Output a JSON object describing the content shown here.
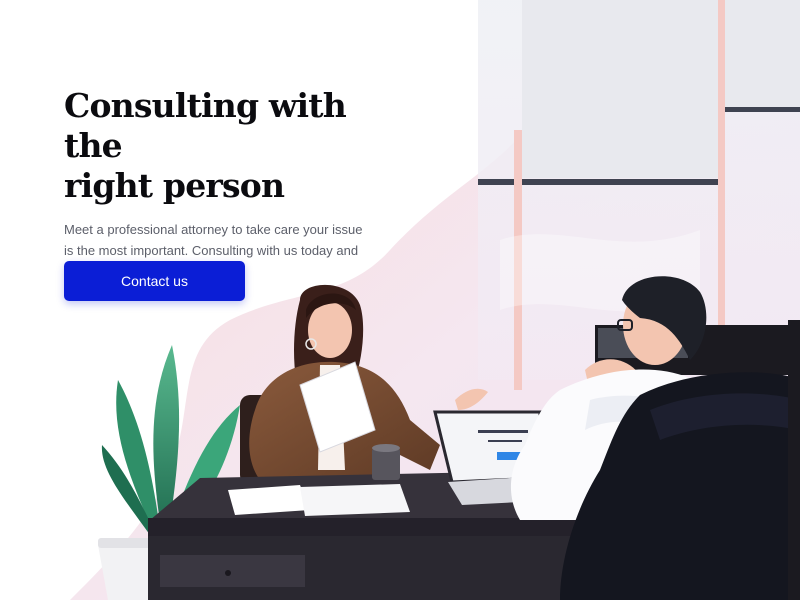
{
  "hero": {
    "headline_line1": "Consulting with the",
    "headline_line2": "right person",
    "subtitle": "Meet a professional attorney to take care your issue is the most important. Consulting with us today and let us take care your matter.",
    "cta_label": "Contact us"
  },
  "colors": {
    "accent": "#0b1ed6",
    "headline": "#0b0b0f",
    "body_text": "#5c5f6a",
    "blob": "#f6e7ea",
    "desk": "#2a2830"
  },
  "illustration": {
    "icons": [
      "office-window-icon",
      "plant-icon",
      "woman-with-paper-icon",
      "man-with-glasses-icon",
      "laptop-icon",
      "coffee-cup-icon",
      "desk-icon",
      "office-chair-icon"
    ]
  }
}
